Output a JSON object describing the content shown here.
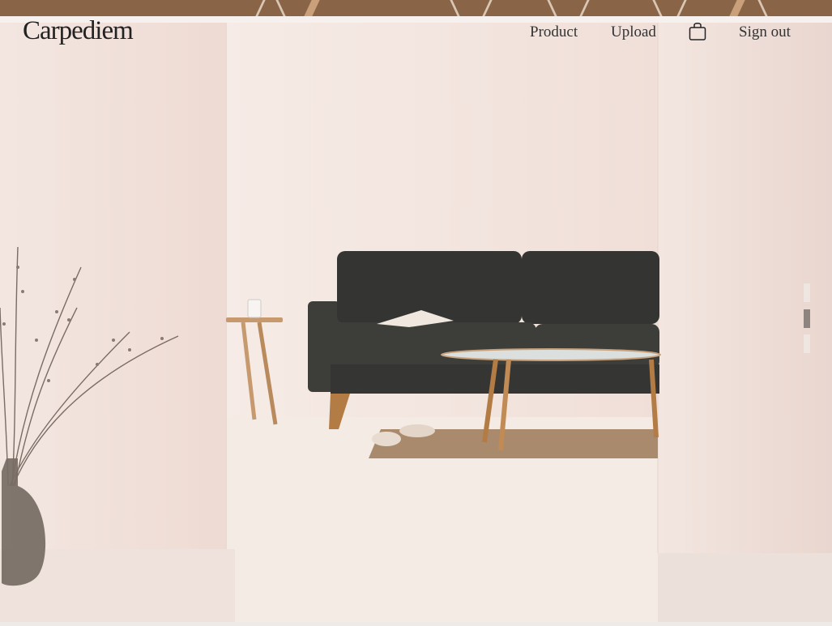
{
  "header": {
    "logo": "Carpediem",
    "nav": [
      "Product",
      "Upload",
      "Sign out"
    ]
  },
  "icons": {
    "cart": "shopping-bag-icon"
  },
  "slider": {
    "count": 3,
    "active": 2
  },
  "colors": {
    "wall": "#f1e4dd",
    "sofa": "#3a3a37",
    "wood": "#b47c45",
    "text": "#222222"
  }
}
